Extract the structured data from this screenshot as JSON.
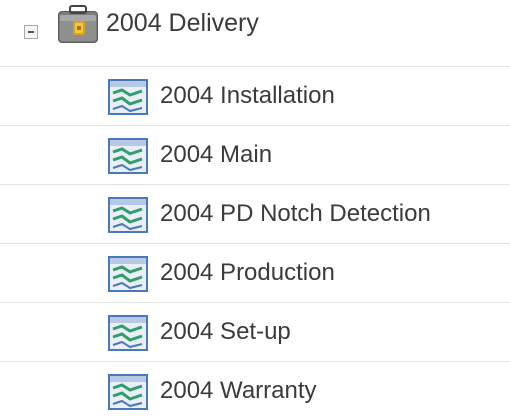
{
  "tree": {
    "parent": {
      "label": "2004 Delivery",
      "icon": "briefcase-folder-icon",
      "expanded": true
    },
    "children": [
      {
        "label": "2004 Installation",
        "icon": "report-chart-icon"
      },
      {
        "label": "2004 Main",
        "icon": "report-chart-icon"
      },
      {
        "label": "2004 PD Notch Detection",
        "icon": "report-chart-icon"
      },
      {
        "label": "2004 Production",
        "icon": "report-chart-icon"
      },
      {
        "label": "2004 Set-up",
        "icon": "report-chart-icon"
      },
      {
        "label": "2004 Warranty",
        "icon": "report-chart-icon"
      }
    ]
  },
  "colors": {
    "text": "#3b3b3b",
    "row_divider": "#e3e3e3",
    "report_icon_blue": "#4a78b8",
    "report_icon_green": "#2f9e6a",
    "folder_gold": "#d9a21b"
  }
}
